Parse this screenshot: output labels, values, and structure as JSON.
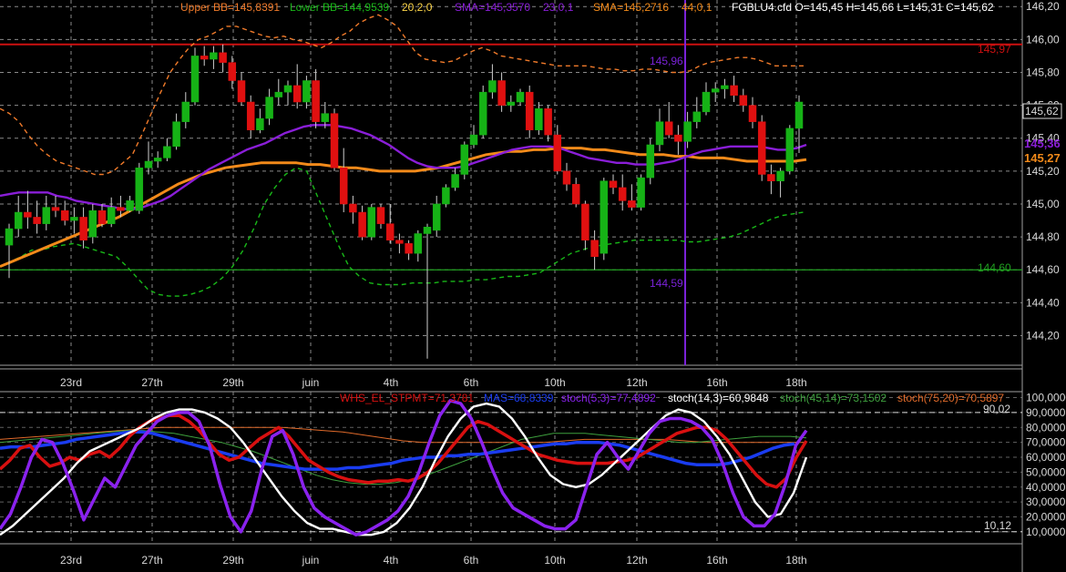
{
  "colors": {
    "background": "#000000",
    "grid": "#8a8a8a",
    "bull": "#16b216",
    "bear": "#e01010",
    "wick": "#d0d0d0",
    "bb_upper": "#f07a2a",
    "bb_lower": "#18b818",
    "sma23": "#8a1ed8",
    "sma44": "#f28a1a",
    "resistance": "#cc1010",
    "support": "#20a020",
    "cursor": "#7a22d8",
    "whs": "#d81010",
    "mass": "#1a3cf0",
    "stoch53": "#8a22ee",
    "stoch143": "#ffffff",
    "stoch4514": "#3ea03e",
    "stoch7520": "#e06a2a",
    "axis_text": "#d8d8d8"
  },
  "header": {
    "upper_bb": "Upper BB=145,8391",
    "lower_bb": "Lower BB=144,9539",
    "bb_params": "20,2,0",
    "sma1": "SMA=145,3570",
    "sma1_params": "23,0,1",
    "sma2": "SMA=145,2716",
    "sma2_params": "44,0,1",
    "ohlc": "FGBLU4.cfd O=145,45 H=145,66 L=145,31 C=145,62"
  },
  "price_axis": {
    "ticks": [
      "146,20",
      "146,00",
      "145,80",
      "145,60",
      "145,40",
      "145,20",
      "145,00",
      "144,80",
      "144,60",
      "144,40",
      "144,20"
    ],
    "last_price": "145,62",
    "sma23_value": "145,36",
    "sma44_value": "145,27"
  },
  "levels": {
    "resistance": "145,97",
    "support": "144,60",
    "cursor_high": "145,96",
    "cursor_low": "144,59"
  },
  "x_labels": [
    "23rd",
    "27th",
    "29th",
    "juin",
    "4th",
    "6th",
    "10th",
    "12th",
    "16th",
    "18th"
  ],
  "osc_header": {
    "whs": "WHS_EL_STPMT=71,3781",
    "mass": "MAS=68,8339",
    "stoch53": "stoch(5,3)=77,4892",
    "stoch143": "stoch(14,3)=60,9848",
    "stoch4514": "stoch(45,14)=73,1502",
    "stoch7520": "stoch(75,20)=70,5897"
  },
  "osc_axis": {
    "ticks": [
      "100,0000",
      "90,0000",
      "80,0000",
      "70,0000",
      "60,0000",
      "50,0000",
      "40,0000",
      "30,0000",
      "20,0000",
      "10,0000"
    ],
    "upper_level": "90,02",
    "lower_level": "10,12"
  },
  "chart_data": {
    "type": "candlestick",
    "instrument": "FGBLU4.cfd",
    "ylim": [
      144.02,
      146.24
    ],
    "osc_ylim": [
      2,
      104
    ],
    "candles": [
      {
        "o": 144.75,
        "h": 144.88,
        "l": 144.55,
        "c": 144.85
      },
      {
        "o": 144.85,
        "h": 145.05,
        "l": 144.8,
        "c": 144.95
      },
      {
        "o": 144.95,
        "h": 145.08,
        "l": 144.85,
        "c": 144.92
      },
      {
        "o": 144.92,
        "h": 145.02,
        "l": 144.82,
        "c": 144.88
      },
      {
        "o": 144.88,
        "h": 145.05,
        "l": 144.84,
        "c": 144.98
      },
      {
        "o": 144.98,
        "h": 145.05,
        "l": 144.92,
        "c": 144.96
      },
      {
        "o": 144.96,
        "h": 145.02,
        "l": 144.87,
        "c": 144.9
      },
      {
        "o": 144.9,
        "h": 144.98,
        "l": 144.82,
        "c": 144.92
      },
      {
        "o": 144.92,
        "h": 144.98,
        "l": 144.73,
        "c": 144.78
      },
      {
        "o": 144.8,
        "h": 145.0,
        "l": 144.76,
        "c": 144.96
      },
      {
        "o": 144.96,
        "h": 145.0,
        "l": 144.86,
        "c": 144.88
      },
      {
        "o": 144.88,
        "h": 145.04,
        "l": 144.86,
        "c": 144.98
      },
      {
        "o": 144.98,
        "h": 145.05,
        "l": 144.92,
        "c": 144.96
      },
      {
        "o": 144.96,
        "h": 145.05,
        "l": 144.95,
        "c": 145.02
      },
      {
        "o": 144.96,
        "h": 145.25,
        "l": 144.94,
        "c": 145.22
      },
      {
        "o": 145.22,
        "h": 145.38,
        "l": 145.18,
        "c": 145.26
      },
      {
        "o": 145.26,
        "h": 145.32,
        "l": 145.22,
        "c": 145.28
      },
      {
        "o": 145.28,
        "h": 145.4,
        "l": 145.26,
        "c": 145.35
      },
      {
        "o": 145.35,
        "h": 145.55,
        "l": 145.33,
        "c": 145.5
      },
      {
        "o": 145.5,
        "h": 145.68,
        "l": 145.46,
        "c": 145.62
      },
      {
        "o": 145.62,
        "h": 145.95,
        "l": 145.6,
        "c": 145.9
      },
      {
        "o": 145.9,
        "h": 145.96,
        "l": 145.84,
        "c": 145.88
      },
      {
        "o": 145.88,
        "h": 145.96,
        "l": 145.82,
        "c": 145.92
      },
      {
        "o": 145.92,
        "h": 145.97,
        "l": 145.8,
        "c": 145.86
      },
      {
        "o": 145.86,
        "h": 145.9,
        "l": 145.7,
        "c": 145.75
      },
      {
        "o": 145.75,
        "h": 145.8,
        "l": 145.6,
        "c": 145.62
      },
      {
        "o": 145.62,
        "h": 145.66,
        "l": 145.4,
        "c": 145.45
      },
      {
        "o": 145.45,
        "h": 145.58,
        "l": 145.43,
        "c": 145.52
      },
      {
        "o": 145.52,
        "h": 145.7,
        "l": 145.48,
        "c": 145.65
      },
      {
        "o": 145.65,
        "h": 145.76,
        "l": 145.6,
        "c": 145.68
      },
      {
        "o": 145.68,
        "h": 145.75,
        "l": 145.6,
        "c": 145.72
      },
      {
        "o": 145.72,
        "h": 145.85,
        "l": 145.58,
        "c": 145.62
      },
      {
        "o": 145.62,
        "h": 145.78,
        "l": 145.58,
        "c": 145.75
      },
      {
        "o": 145.75,
        "h": 145.82,
        "l": 145.46,
        "c": 145.5
      },
      {
        "o": 145.5,
        "h": 145.62,
        "l": 145.46,
        "c": 145.55
      },
      {
        "o": 145.55,
        "h": 145.58,
        "l": 145.2,
        "c": 145.22
      },
      {
        "o": 145.22,
        "h": 145.34,
        "l": 144.95,
        "c": 145.0
      },
      {
        "o": 145.0,
        "h": 145.05,
        "l": 144.88,
        "c": 144.95
      },
      {
        "o": 144.95,
        "h": 144.99,
        "l": 144.78,
        "c": 144.8
      },
      {
        "o": 144.8,
        "h": 145.0,
        "l": 144.78,
        "c": 144.98
      },
      {
        "o": 144.98,
        "h": 145.0,
        "l": 144.85,
        "c": 144.88
      },
      {
        "o": 144.88,
        "h": 145.0,
        "l": 144.76,
        "c": 144.78
      },
      {
        "o": 144.78,
        "h": 144.82,
        "l": 144.7,
        "c": 144.76
      },
      {
        "o": 144.76,
        "h": 144.78,
        "l": 144.66,
        "c": 144.7
      },
      {
        "o": 144.7,
        "h": 144.84,
        "l": 144.65,
        "c": 144.82
      },
      {
        "o": 144.82,
        "h": 144.88,
        "l": 144.06,
        "c": 144.86
      },
      {
        "o": 144.84,
        "h": 145.05,
        "l": 144.8,
        "c": 145.0
      },
      {
        "o": 145.0,
        "h": 145.12,
        "l": 144.98,
        "c": 145.1
      },
      {
        "o": 145.1,
        "h": 145.22,
        "l": 145.08,
        "c": 145.18
      },
      {
        "o": 145.18,
        "h": 145.38,
        "l": 145.15,
        "c": 145.36
      },
      {
        "o": 145.36,
        "h": 145.48,
        "l": 145.34,
        "c": 145.42
      },
      {
        "o": 145.42,
        "h": 145.72,
        "l": 145.4,
        "c": 145.68
      },
      {
        "o": 145.68,
        "h": 145.85,
        "l": 145.64,
        "c": 145.75
      },
      {
        "o": 145.75,
        "h": 145.8,
        "l": 145.56,
        "c": 145.6
      },
      {
        "o": 145.6,
        "h": 145.66,
        "l": 145.56,
        "c": 145.62
      },
      {
        "o": 145.62,
        "h": 145.7,
        "l": 145.6,
        "c": 145.68
      },
      {
        "o": 145.68,
        "h": 145.72,
        "l": 145.4,
        "c": 145.45
      },
      {
        "o": 145.45,
        "h": 145.62,
        "l": 145.42,
        "c": 145.58
      },
      {
        "o": 145.58,
        "h": 145.6,
        "l": 145.38,
        "c": 145.42
      },
      {
        "o": 145.42,
        "h": 145.48,
        "l": 145.18,
        "c": 145.2
      },
      {
        "o": 145.2,
        "h": 145.25,
        "l": 145.08,
        "c": 145.12
      },
      {
        "o": 145.12,
        "h": 145.16,
        "l": 144.98,
        "c": 145.0
      },
      {
        "o": 145.0,
        "h": 145.02,
        "l": 144.72,
        "c": 144.78
      },
      {
        "o": 144.78,
        "h": 144.84,
        "l": 144.6,
        "c": 144.68
      },
      {
        "o": 144.7,
        "h": 145.16,
        "l": 144.66,
        "c": 145.14
      },
      {
        "o": 145.14,
        "h": 145.18,
        "l": 145.06,
        "c": 145.1
      },
      {
        "o": 145.1,
        "h": 145.18,
        "l": 144.96,
        "c": 145.02
      },
      {
        "o": 145.02,
        "h": 145.12,
        "l": 144.96,
        "c": 144.98
      },
      {
        "o": 144.98,
        "h": 145.18,
        "l": 144.96,
        "c": 145.16
      },
      {
        "o": 145.16,
        "h": 145.4,
        "l": 145.12,
        "c": 145.36
      },
      {
        "o": 145.36,
        "h": 145.58,
        "l": 145.32,
        "c": 145.5
      },
      {
        "o": 145.5,
        "h": 145.62,
        "l": 145.4,
        "c": 145.42
      },
      {
        "o": 145.42,
        "h": 145.48,
        "l": 145.3,
        "c": 145.38
      },
      {
        "o": 145.38,
        "h": 145.56,
        "l": 145.34,
        "c": 145.5
      },
      {
        "o": 145.5,
        "h": 145.65,
        "l": 145.46,
        "c": 145.56
      },
      {
        "o": 145.56,
        "h": 145.74,
        "l": 145.54,
        "c": 145.68
      },
      {
        "o": 145.68,
        "h": 145.74,
        "l": 145.62,
        "c": 145.7
      },
      {
        "o": 145.7,
        "h": 145.76,
        "l": 145.64,
        "c": 145.72
      },
      {
        "o": 145.72,
        "h": 145.78,
        "l": 145.62,
        "c": 145.66
      },
      {
        "o": 145.66,
        "h": 145.7,
        "l": 145.56,
        "c": 145.6
      },
      {
        "o": 145.6,
        "h": 145.65,
        "l": 145.46,
        "c": 145.5
      },
      {
        "o": 145.5,
        "h": 145.54,
        "l": 145.14,
        "c": 145.18
      },
      {
        "o": 145.18,
        "h": 145.24,
        "l": 145.06,
        "c": 145.14
      },
      {
        "o": 145.14,
        "h": 145.22,
        "l": 145.04,
        "c": 145.2
      },
      {
        "o": 145.2,
        "h": 145.48,
        "l": 145.18,
        "c": 145.46
      },
      {
        "o": 145.46,
        "h": 145.66,
        "l": 145.31,
        "c": 145.62
      }
    ],
    "bb_upper": [
      145.58,
      145.55,
      145.5,
      145.42,
      145.35,
      145.3,
      145.26,
      145.24,
      145.22,
      145.2,
      145.18,
      145.18,
      145.2,
      145.25,
      145.3,
      145.42,
      145.55,
      145.68,
      145.8,
      145.88,
      145.95,
      146.0,
      146.02,
      146.05,
      146.08,
      146.08,
      146.06,
      146.04,
      146.02,
      146.01,
      146.02,
      146.0,
      145.99,
      145.97,
      145.95,
      145.98,
      146.02,
      146.05,
      146.1,
      146.13,
      146.15,
      146.12,
      146.08,
      146.0,
      145.92,
      145.88,
      145.87,
      145.86,
      145.87,
      145.9,
      145.93,
      145.95,
      145.93,
      145.9,
      145.89,
      145.88,
      145.87,
      145.86,
      145.85,
      145.84,
      145.84,
      145.84,
      145.84,
      145.83,
      145.82,
      145.82,
      145.81,
      145.81,
      145.82,
      145.82,
      145.81,
      145.8,
      145.8,
      145.81,
      145.84,
      145.86,
      145.87,
      145.88,
      145.89,
      145.89,
      145.88,
      145.86,
      145.84,
      145.84,
      145.84,
      145.84
    ],
    "bb_lower": [
      144.62,
      144.65,
      144.68,
      144.72,
      144.72,
      144.74,
      144.75,
      144.76,
      144.74,
      144.72,
      144.7,
      144.68,
      144.62,
      144.55,
      144.48,
      144.45,
      144.44,
      144.44,
      144.45,
      144.47,
      144.5,
      144.55,
      144.62,
      144.72,
      144.85,
      145.0,
      145.1,
      145.18,
      145.22,
      145.2,
      145.05,
      144.9,
      144.75,
      144.62,
      144.56,
      144.52,
      144.51,
      144.51,
      144.51,
      144.52,
      144.52,
      144.52,
      144.53,
      144.53,
      144.53,
      144.54,
      144.54,
      144.55,
      144.56,
      144.56,
      144.57,
      144.58,
      144.62,
      144.66,
      144.7,
      144.72,
      144.74,
      144.75,
      144.76,
      144.77,
      144.78,
      144.78,
      144.78,
      144.78,
      144.78,
      144.77,
      144.77,
      144.78,
      144.79,
      144.8,
      144.82,
      144.85,
      144.88,
      144.91,
      144.93,
      144.94,
      144.95
    ],
    "sma23": [
      145.05,
      145.06,
      145.07,
      145.07,
      145.07,
      145.07,
      145.05,
      145.04,
      145.02,
      145.01,
      145.0,
      144.99,
      144.98,
      144.97,
      144.97,
      144.98,
      145.0,
      145.02,
      145.05,
      145.09,
      145.13,
      145.17,
      145.21,
      145.24,
      145.27,
      145.3,
      145.33,
      145.35,
      145.37,
      145.4,
      145.43,
      145.45,
      145.47,
      145.48,
      145.48,
      145.48,
      145.47,
      145.46,
      145.44,
      145.42,
      145.39,
      145.36,
      145.32,
      145.28,
      145.25,
      145.23,
      145.22,
      145.22,
      145.22,
      145.23,
      145.25,
      145.27,
      145.29,
      145.31,
      145.33,
      145.34,
      145.35,
      145.35,
      145.35,
      145.34,
      145.32,
      145.3,
      145.28,
      145.27,
      145.26,
      145.25,
      145.25,
      145.24,
      145.24,
      145.24,
      145.25,
      145.26,
      145.28,
      145.3,
      145.32,
      145.33,
      145.34,
      145.35,
      145.35,
      145.35,
      145.35,
      145.34,
      145.33,
      145.33,
      145.34,
      145.36
    ],
    "sma44": [
      144.62,
      144.65,
      144.68,
      144.71,
      144.74,
      144.77,
      144.8,
      144.83,
      144.86,
      144.89,
      144.92,
      144.96,
      145.0,
      145.04,
      145.08,
      145.12,
      145.15,
      145.18,
      145.2,
      145.22,
      145.23,
      145.24,
      145.25,
      145.25,
      145.25,
      145.25,
      145.24,
      145.24,
      145.23,
      145.22,
      145.22,
      145.21,
      145.2,
      145.2,
      145.2,
      145.2,
      145.21,
      145.22,
      145.24,
      145.26,
      145.28,
      145.3,
      145.31,
      145.32,
      145.32,
      145.33,
      145.33,
      145.34,
      145.34,
      145.34,
      145.33,
      145.33,
      145.32,
      145.31,
      145.3,
      145.3,
      145.3,
      145.29,
      145.29,
      145.28,
      145.28,
      145.28,
      145.27,
      145.26,
      145.26,
      145.26,
      145.26,
      145.26,
      145.27
    ],
    "whs": [
      52,
      58,
      66,
      68,
      60,
      54,
      56,
      60,
      58,
      62,
      64,
      60,
      66,
      74,
      80,
      84,
      86,
      88,
      88,
      84,
      78,
      70,
      62,
      58,
      60,
      66,
      72,
      76,
      80,
      74,
      66,
      58,
      54,
      50,
      47,
      45,
      44,
      43,
      44,
      44,
      45,
      44,
      46,
      50,
      56,
      64,
      72,
      80,
      84,
      82,
      78,
      74,
      70,
      66,
      62,
      60,
      58,
      57,
      56,
      56,
      56,
      56,
      57,
      58,
      60,
      64,
      68,
      72,
      76,
      78,
      80,
      80,
      78,
      72,
      64,
      56,
      48,
      42,
      40,
      46,
      60,
      71
    ],
    "mass": [
      66,
      67,
      67,
      67,
      68,
      69,
      70,
      72,
      73,
      74,
      75,
      76,
      77,
      77,
      76,
      74,
      72,
      70,
      68,
      66,
      64,
      62,
      60,
      58,
      56,
      55,
      54,
      53,
      52,
      52,
      52,
      52,
      53,
      53,
      54,
      55,
      56,
      58,
      59,
      60,
      60,
      61,
      61,
      62,
      62,
      63,
      64,
      65,
      66,
      67,
      68,
      69,
      69,
      70,
      70,
      70,
      69,
      68,
      66,
      64,
      62,
      60,
      58,
      56,
      55,
      55,
      55,
      56,
      58,
      60,
      63,
      66,
      68,
      69
    ],
    "stoch53": [
      12,
      22,
      40,
      60,
      72,
      70,
      56,
      38,
      18,
      32,
      46,
      40,
      54,
      68,
      76,
      84,
      88,
      90,
      90,
      84,
      68,
      42,
      20,
      10,
      24,
      52,
      74,
      78,
      62,
      40,
      26,
      20,
      16,
      12,
      8,
      10,
      14,
      18,
      24,
      34,
      50,
      70,
      88,
      98,
      96,
      86,
      70,
      52,
      36,
      26,
      22,
      18,
      14,
      12,
      12,
      18,
      40,
      62,
      70,
      60,
      52,
      64,
      76,
      84,
      86,
      86,
      84,
      80,
      72,
      56,
      36,
      20,
      14,
      14,
      22,
      42,
      68,
      78
    ],
    "stoch143": [
      8,
      14,
      22,
      30,
      38,
      46,
      56,
      64,
      68,
      72,
      76,
      80,
      86,
      90,
      92,
      92,
      90,
      86,
      80,
      70,
      58,
      46,
      34,
      24,
      16,
      12,
      12,
      10,
      8,
      8,
      10,
      16,
      26,
      40,
      58,
      74,
      86,
      94,
      96,
      94,
      86,
      74,
      60,
      48,
      42,
      40,
      42,
      48,
      56,
      64,
      72,
      80,
      88,
      92,
      90,
      84,
      74,
      62,
      46,
      30,
      20,
      22,
      36,
      60
    ],
    "stoch4514": [
      70,
      71,
      72,
      73,
      74,
      75,
      76,
      77,
      78,
      78,
      77,
      76,
      74,
      72,
      70,
      67,
      64,
      60,
      56,
      52,
      48,
      45,
      43,
      42,
      42,
      43,
      45,
      48,
      52,
      56,
      60,
      64,
      68,
      72,
      74,
      76,
      76,
      76,
      75,
      74,
      73,
      72,
      71,
      70,
      70,
      71,
      72,
      73,
      74,
      74,
      74,
      73
    ],
    "stoch7520": [
      72,
      73,
      74,
      75,
      76,
      77,
      78,
      79,
      80,
      80,
      80,
      80,
      80,
      80,
      80,
      79,
      78,
      77,
      75,
      73,
      71,
      70,
      70,
      70,
      70,
      70,
      70,
      70,
      71,
      72,
      72,
      72,
      72,
      72,
      71,
      70,
      70,
      70,
      70,
      70,
      70
    ]
  }
}
